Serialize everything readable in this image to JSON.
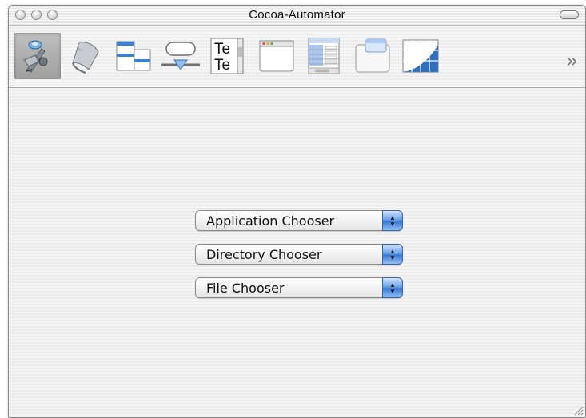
{
  "window": {
    "title": "Cocoa-Automator"
  },
  "toolbar": {
    "items": [
      {
        "icon": "automator-robot-icon",
        "selected": true
      },
      {
        "icon": "script-scroll-icon",
        "selected": false
      },
      {
        "icon": "split-view-icon",
        "selected": false
      },
      {
        "icon": "button-slider-icon",
        "selected": false
      },
      {
        "icon": "text-view-icon",
        "label": "Te",
        "selected": false
      },
      {
        "icon": "window-icon",
        "selected": false
      },
      {
        "icon": "table-view-icon",
        "selected": false
      },
      {
        "icon": "drawer-panel-icon",
        "selected": false
      },
      {
        "icon": "grid-chart-icon",
        "selected": false
      }
    ],
    "overflow_glyph": "»"
  },
  "choosers": [
    {
      "label": "Application Chooser"
    },
    {
      "label": "Directory Chooser"
    },
    {
      "label": "File Chooser"
    }
  ]
}
